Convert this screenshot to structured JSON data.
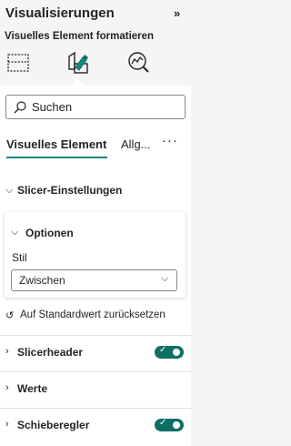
{
  "pane": {
    "title": "Visualisierungen",
    "collapse_icon": "double-chevron-right-icon",
    "subtitle": "Visuelles Element formatieren"
  },
  "view_icons": [
    {
      "name": "build-visual-icon",
      "active": false
    },
    {
      "name": "format-visual-icon",
      "active": true
    },
    {
      "name": "analytics-icon",
      "active": false
    }
  ],
  "search": {
    "placeholder": "Suchen"
  },
  "tabs": [
    {
      "label": "Visuelles Element",
      "active": true
    },
    {
      "label": "Allg...",
      "active": false
    }
  ],
  "tabs_more": "···",
  "sections": {
    "slicer_settings": {
      "label": "Slicer-Einstellungen",
      "expanded": true
    },
    "options": {
      "label": "Optionen",
      "expanded": true,
      "style_label": "Stil",
      "style_value": "Zwischen"
    },
    "reset_label": "Auf Standardwert zurücksetzen",
    "slicer_header": {
      "label": "Slicerheader",
      "toggle_on": true
    },
    "values": {
      "label": "Werte"
    },
    "slider": {
      "label": "Schieberegler",
      "toggle_on": true
    }
  },
  "colors": {
    "accent": "#118a7e",
    "toggle_on": "#0f6f65",
    "panel_bg": "#ffffff",
    "header_bg": "#f5f5f5"
  }
}
